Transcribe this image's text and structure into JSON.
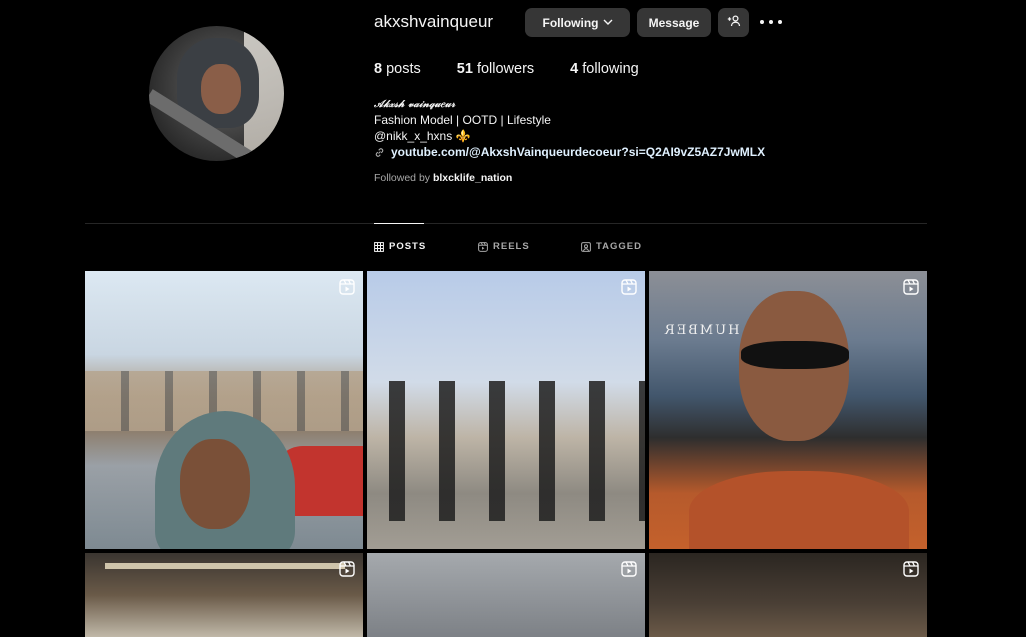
{
  "profile": {
    "username": "akxshvainqueur",
    "following_label": "Following",
    "message_label": "Message",
    "stats": {
      "posts_count": "8",
      "posts_label": "posts",
      "followers_count": "51",
      "followers_label": "followers",
      "following_count": "4",
      "following_label": "following"
    },
    "bio": {
      "display_name": "𝒜𝓀𝓍𝓈𝒽 𝓋𝒶𝒾𝓃𝓆𝓊𝑒𝓊𝓇",
      "line1": "Fashion Model | OOTD | Lifestyle",
      "line2": "@nikk_x_hxns ⚜️",
      "link": "youtube.com/@AkxshVainqueurdecoeur?si=Q2AI9vZ5AZ7JwMLX"
    },
    "followed_by_prefix": "Followed by",
    "followed_by_user": "blxcklife_nation"
  },
  "tabs": [
    {
      "label": "POSTS",
      "active": true,
      "icon": "grid-icon"
    },
    {
      "label": "REELS",
      "active": false,
      "icon": "reels-icon"
    },
    {
      "label": "TAGGED",
      "active": false,
      "icon": "tagged-icon"
    }
  ],
  "grid": {
    "tiles": [
      {
        "type": "reel"
      },
      {
        "type": "reel"
      },
      {
        "type": "reel"
      },
      {
        "type": "reel"
      },
      {
        "type": "reel"
      },
      {
        "type": "reel"
      }
    ],
    "tile3_sign": "HUMBER"
  },
  "colors": {
    "background": "#000000",
    "button": "#363636",
    "link": "#e0f1ff",
    "muted": "#a8a8a8"
  }
}
